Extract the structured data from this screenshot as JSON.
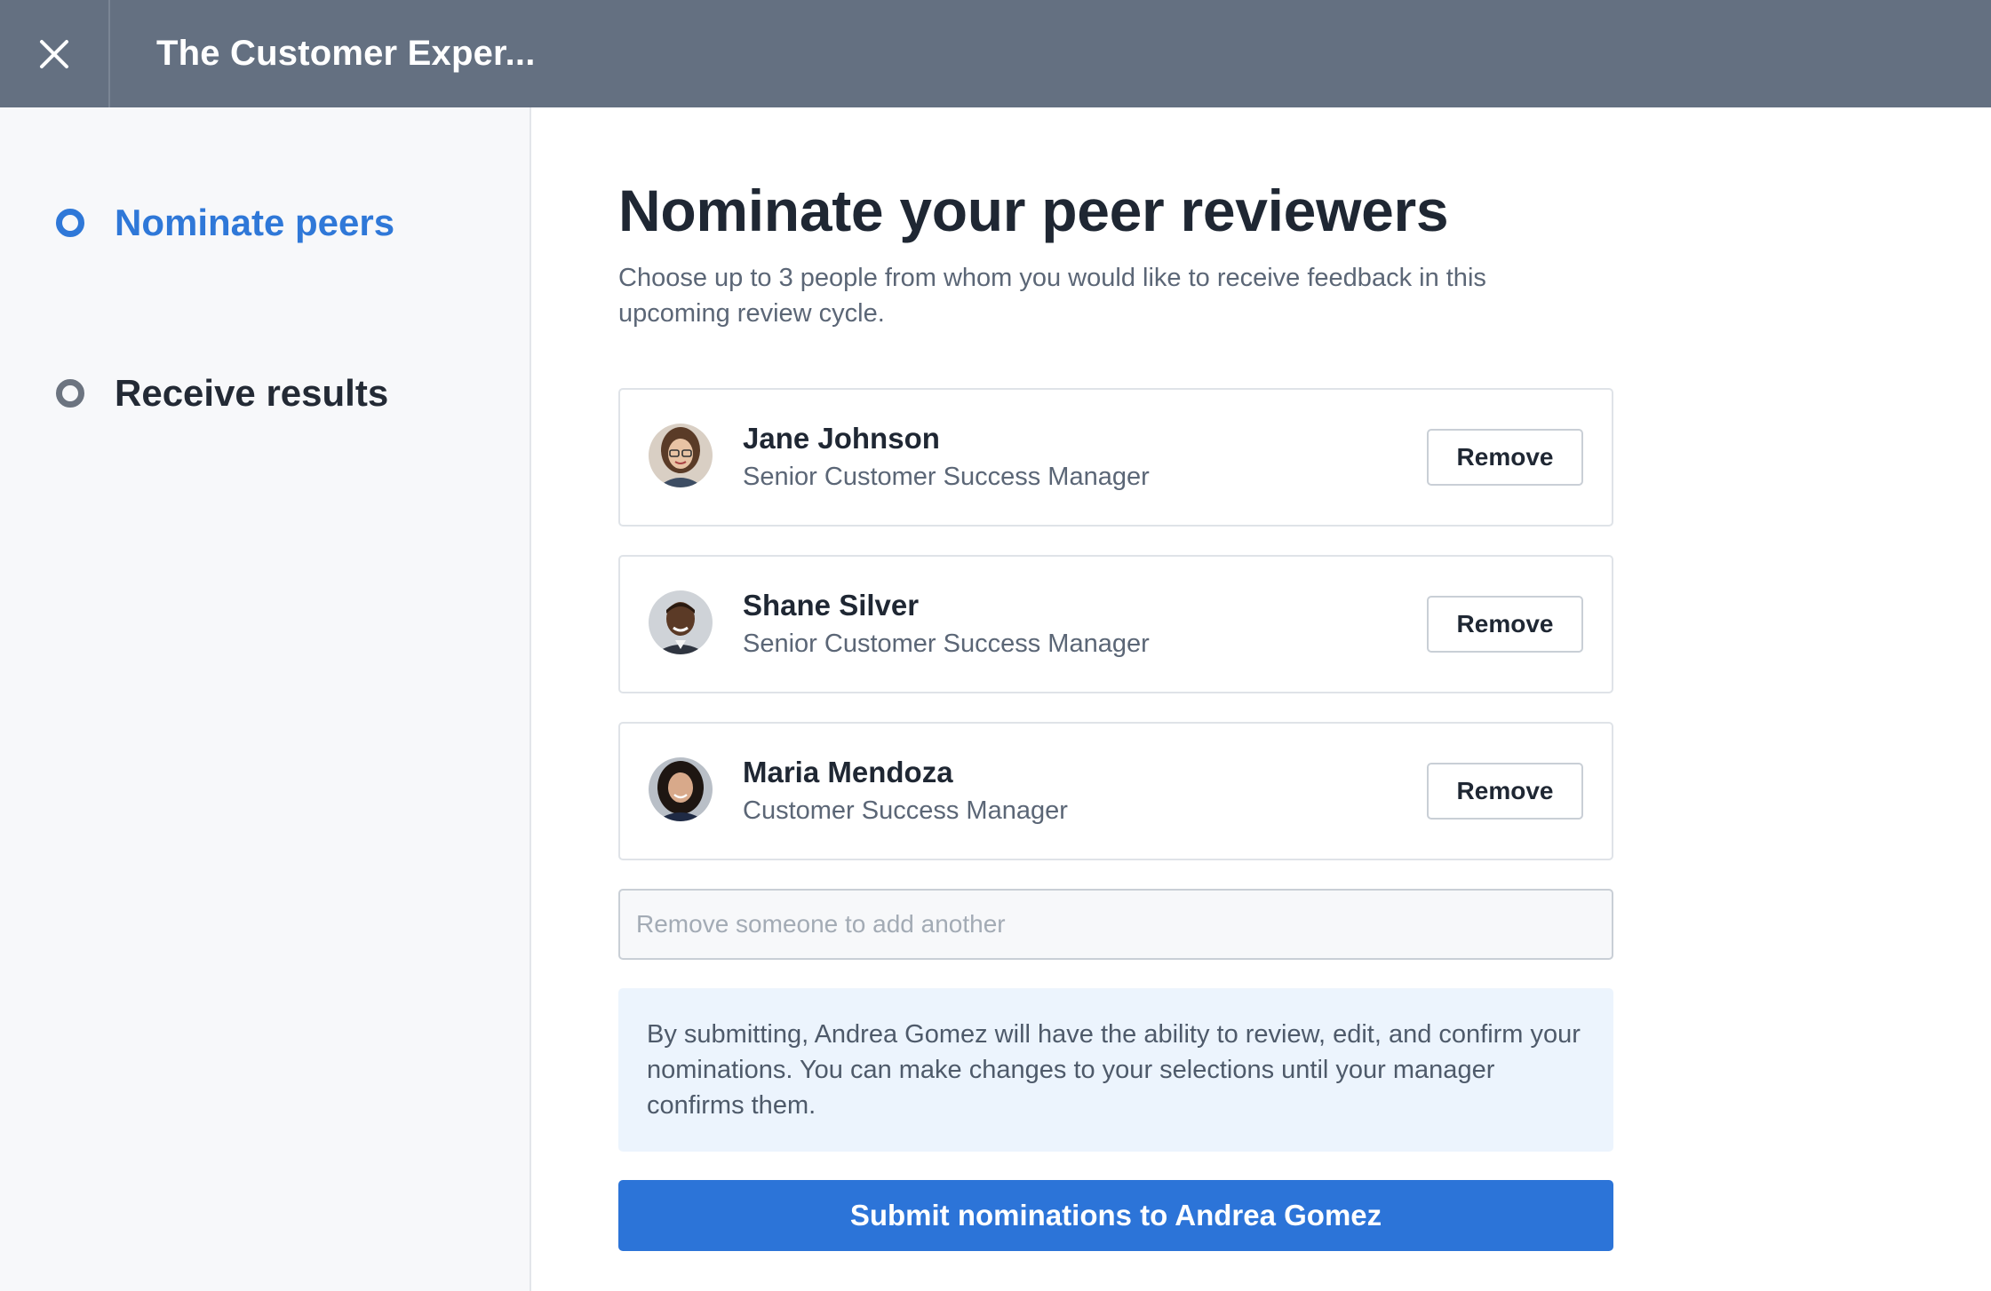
{
  "header": {
    "title": "The Customer Exper...",
    "close_icon": "close-icon"
  },
  "sidebar": {
    "steps": [
      {
        "label": "Nominate peers",
        "state": "active",
        "icon": "step-ring-icon"
      },
      {
        "label": "Receive results",
        "state": "inactive",
        "icon": "step-ring-icon"
      }
    ]
  },
  "main": {
    "title": "Nominate your peer reviewers",
    "subtitle": "Choose up to 3 people from whom you would like to receive feedback in this upcoming review cycle.",
    "peers": [
      {
        "name": "Jane Johnson",
        "role": "Senior Customer Success Manager",
        "remove_label": "Remove"
      },
      {
        "name": "Shane Silver",
        "role": "Senior Customer Success Manager",
        "remove_label": "Remove"
      },
      {
        "name": "Maria Mendoza",
        "role": "Customer Success Manager",
        "remove_label": "Remove"
      }
    ],
    "add_placeholder": "Remove someone to add another",
    "info_text": "By submitting, Andrea Gomez will have the ability to review, edit, and confirm your nominations. You can make changes to your selections until your manager confirms them.",
    "submit_label": "Submit nominations to Andrea Gomez"
  },
  "colors": {
    "header_bg": "#647081",
    "accent": "#2f78d8",
    "submit_bg": "#2c74d8",
    "sidebar_bg": "#f7f8fa",
    "info_bg": "#ecf4fd"
  }
}
